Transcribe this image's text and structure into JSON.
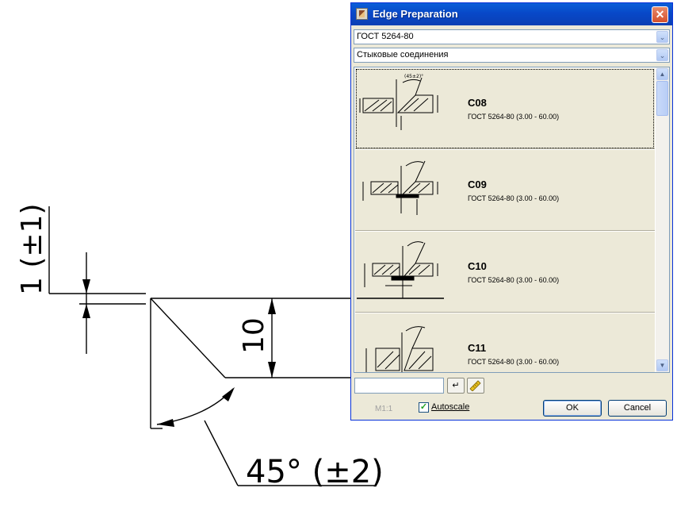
{
  "drawing": {
    "gap_dimension": "1 (±1)",
    "height_dimension": "10",
    "angle_dimension": "45° (±2)"
  },
  "dialog": {
    "title": "Edge Preparation",
    "close_glyph": "✕",
    "standard_select": {
      "value": "ГОСТ 5264-80",
      "arrow": "⌄"
    },
    "joint_type_select": {
      "value": "Стыковые соединения",
      "arrow": "⌄"
    },
    "items": [
      {
        "code": "C08",
        "description": "ГОСТ 5264-80 (3.00 - 60.00)",
        "selected": true
      },
      {
        "code": "C09",
        "description": "ГОСТ 5264-80 (3.00 - 60.00)",
        "selected": false
      },
      {
        "code": "C10",
        "description": "ГОСТ 5264-80 (3.00 - 60.00)",
        "selected": false
      },
      {
        "code": "C11",
        "description": "ГОСТ 5264-80 (3.00 - 60.00)",
        "selected": false
      }
    ],
    "scroll_up_glyph": "▲",
    "scroll_down_glyph": "▼",
    "value_input": "",
    "enter_glyph": "↵",
    "measure_icon": "ruler-icon",
    "scale_label": "M1:1",
    "autoscale": {
      "label": "Autoscale",
      "checked": true,
      "check_glyph": "✓"
    },
    "ok_label": "OK",
    "cancel_label": "Cancel",
    "colors": {
      "titlebar": "#0a5fd8",
      "dialog_bg": "#ece9d8",
      "close": "#d4502c"
    }
  }
}
